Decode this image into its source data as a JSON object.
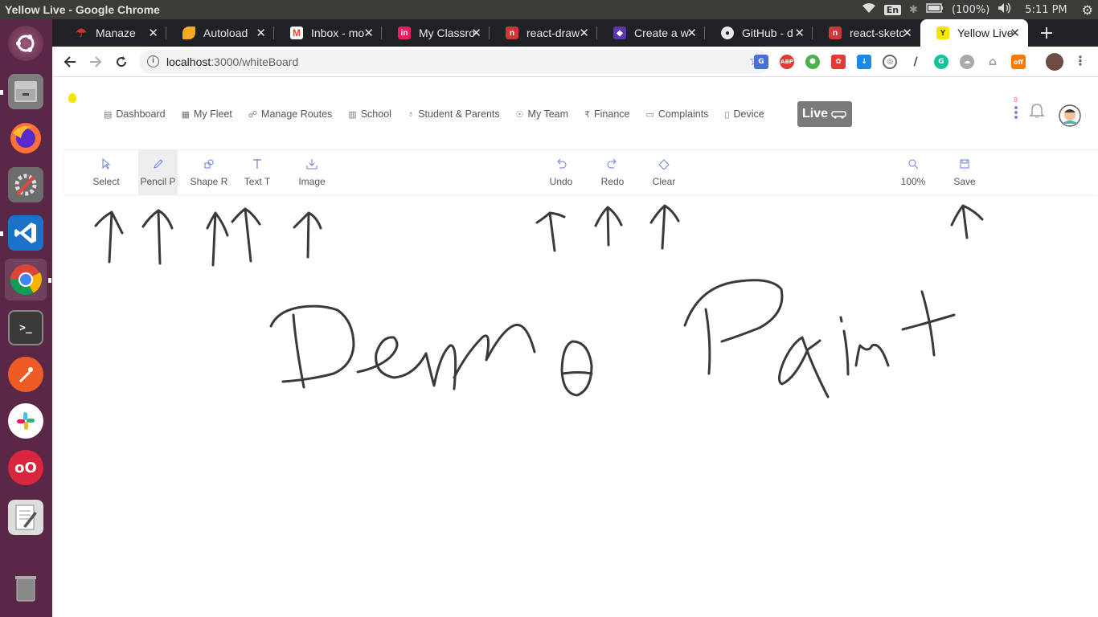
{
  "system": {
    "window_title": "Yellow Live - Google Chrome",
    "keyboard_layout": "En",
    "battery": "(100%)",
    "clock": "5:11 PM"
  },
  "launcher": {
    "items": [
      {
        "name": "ubuntu-dash",
        "color": "#dd4814"
      },
      {
        "name": "files",
        "color": "#8a8a8a"
      },
      {
        "name": "firefox",
        "color": "#ff7139"
      },
      {
        "name": "system-settings",
        "color": "#8b8b8b"
      },
      {
        "name": "vscode",
        "color": "#1a73c6"
      },
      {
        "name": "chrome",
        "color": "#4285f4"
      },
      {
        "name": "terminal",
        "color": "#2c2c2c"
      },
      {
        "name": "postman",
        "color": "#ef5b25"
      },
      {
        "name": "slack",
        "color": "#ffffff"
      },
      {
        "name": "remote-app",
        "color": "#d7263d"
      },
      {
        "name": "text-editor",
        "color": "#e8e8e8"
      },
      {
        "name": "trash",
        "color": "#7a7a7a"
      }
    ]
  },
  "tabs": [
    {
      "label": "Manaze",
      "fav_color": "#d32f2f",
      "fav_icon": "umbrella-icon"
    },
    {
      "label": "Autoload",
      "fav_color": "#f9a825",
      "fav_icon": "autoload-icon"
    },
    {
      "label": "Inbox - mo",
      "fav_color": "#ea4335",
      "fav_icon": "gmail-icon"
    },
    {
      "label": "My Classro",
      "fav_color": "#e91e63",
      "fav_icon": "invision-icon"
    },
    {
      "label": "react-draw",
      "fav_color": "#cb3837",
      "fav_icon": "npm-icon"
    },
    {
      "label": "Create a w",
      "fav_color": "#5e35b1",
      "fav_icon": "cube-icon"
    },
    {
      "label": "GitHub - d",
      "fav_color": "#24292e",
      "fav_icon": "github-icon"
    },
    {
      "label": "react-sketc",
      "fav_color": "#cb3837",
      "fav_icon": "npm-icon"
    },
    {
      "label": "Yellow Live",
      "fav_color": "#f5e600",
      "fav_icon": "yellow-live-icon",
      "active": true
    }
  ],
  "address_bar": {
    "host": "localhost",
    "path": ":3000/whiteBoard"
  },
  "app_nav": {
    "items": [
      {
        "label": "Dashboard",
        "icon": "dashboard-icon"
      },
      {
        "label": "My Fleet",
        "icon": "bus-icon"
      },
      {
        "label": "Manage Routes",
        "icon": "route-icon"
      },
      {
        "label": "School",
        "icon": "school-icon"
      },
      {
        "label": "Student & Parents",
        "icon": "people-icon"
      },
      {
        "label": "My Team",
        "icon": "team-icon"
      },
      {
        "label": "Finance",
        "icon": "rupee-icon"
      },
      {
        "label": "Complaints",
        "icon": "chat-icon"
      },
      {
        "label": "Device",
        "icon": "device-icon"
      }
    ],
    "live_label": "Live",
    "notification_count": "8"
  },
  "whiteboard_tools": {
    "left": [
      {
        "label": "Select",
        "icon": "cursor-icon"
      },
      {
        "label": "Pencil P",
        "icon": "pencil-icon",
        "active": true
      },
      {
        "label": "Shape R",
        "icon": "shape-icon"
      },
      {
        "label": "Text T",
        "icon": "text-icon"
      },
      {
        "label": "Image",
        "icon": "image-upload-icon"
      }
    ],
    "middle": [
      {
        "label": "Undo",
        "icon": "undo-icon"
      },
      {
        "label": "Redo",
        "icon": "redo-icon"
      },
      {
        "label": "Clear",
        "icon": "eraser-icon"
      }
    ],
    "right": [
      {
        "label": "100%",
        "icon": "zoom-icon"
      },
      {
        "label": "Save",
        "icon": "save-icon"
      }
    ]
  },
  "canvas": {
    "stroke_color": "#3a3a3a"
  }
}
